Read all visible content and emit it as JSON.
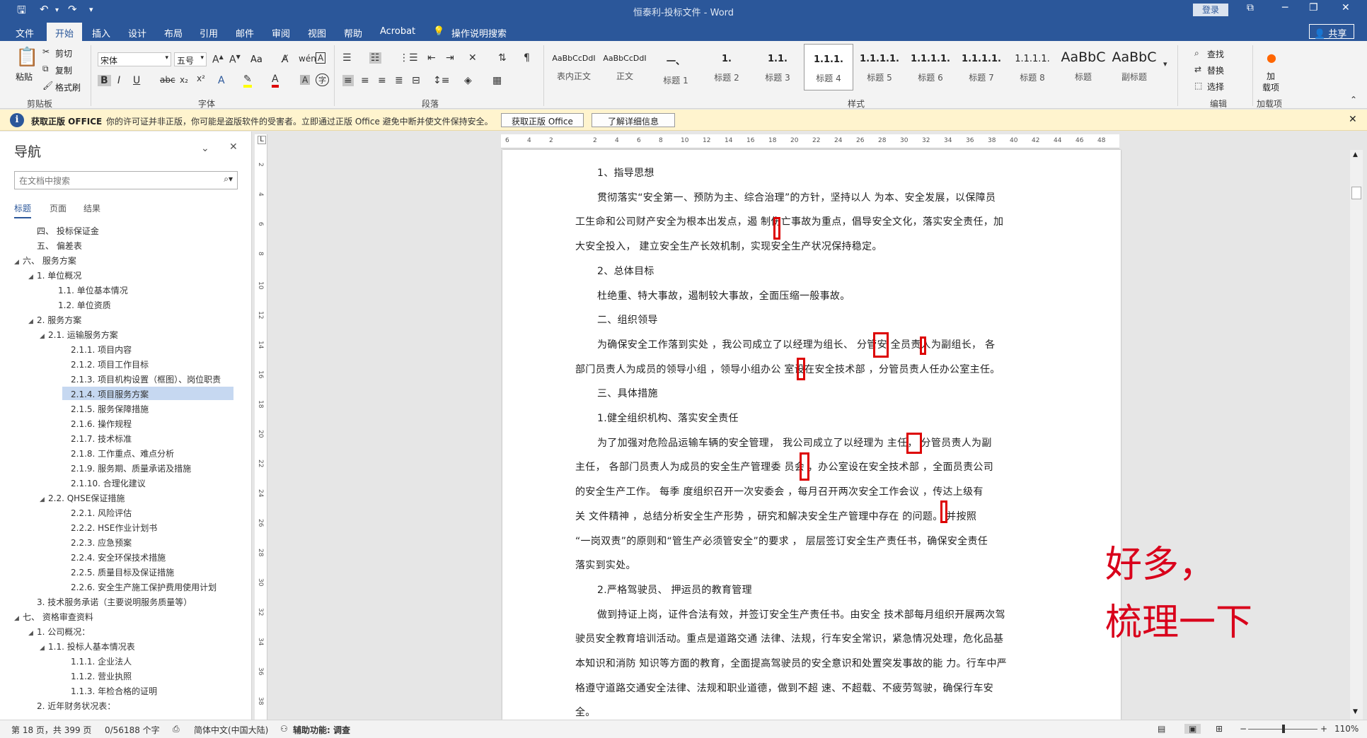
{
  "titlebar": {
    "title": "恒泰利-投标文件 - Word",
    "login": "登录",
    "save_icon": "save-icon",
    "undo_icon": "undo-icon",
    "redo_icon": "redo-icon"
  },
  "menu": {
    "tabs": [
      "文件",
      "开始",
      "插入",
      "设计",
      "布局",
      "引用",
      "邮件",
      "审阅",
      "视图",
      "帮助",
      "Acrobat"
    ],
    "tellme": "操作说明搜索",
    "share": "共享"
  },
  "ribbon": {
    "clipboard": {
      "paste": "粘贴",
      "cut": "剪切",
      "copy": "复制",
      "format_painter": "格式刷",
      "label": "剪贴板"
    },
    "font": {
      "name": "宋体",
      "size": "五号",
      "label": "字体",
      "aa": "Aa"
    },
    "paragraph": {
      "label": "段落"
    },
    "styles": {
      "label": "样式",
      "items": [
        {
          "preview": "AaBbCcDdI",
          "name": "表内正文"
        },
        {
          "preview": "AaBbCcDdI",
          "name": "正文"
        },
        {
          "preview": "一、",
          "name": "标题 1"
        },
        {
          "preview": "1.",
          "name": "标题 2"
        },
        {
          "preview": "1.1.",
          "name": "标题 3"
        },
        {
          "preview": "1.1.1.",
          "name": "标题 4"
        },
        {
          "preview": "1.1.1.1.",
          "name": "标题 5"
        },
        {
          "preview": "1.1.1.1.",
          "name": "标题 6"
        },
        {
          "preview": "1.1.1.1.",
          "name": "标题 7"
        },
        {
          "preview": "1.1.1.1.",
          "name": "标题 8"
        },
        {
          "preview": "AaBbC",
          "name": "标题"
        },
        {
          "preview": "AaBbC",
          "name": "副标题"
        }
      ]
    },
    "editing": {
      "find": "查找",
      "replace": "替换",
      "select": "选择",
      "label": "编辑"
    },
    "addins": {
      "btn": "加\n载项",
      "label": "加载项"
    }
  },
  "warning": {
    "title": "获取正版 OFFICE",
    "text": "你的许可证并非正版，你可能是盗版软件的受害者。立即通过正版 Office 避免中断并使文件保持安全。",
    "btn1": "获取正版 Office",
    "btn2": "了解详细信息"
  },
  "nav": {
    "title": "导航",
    "search_placeholder": "在文档中搜索",
    "tabs": [
      "标题",
      "页面",
      "结果"
    ],
    "items": [
      {
        "text": "四、 投标保证金",
        "level": 1,
        "tri": ""
      },
      {
        "text": "五、 偏差表",
        "level": 1,
        "tri": ""
      },
      {
        "text": "六、 服务方案",
        "level": 0,
        "tri": "◢"
      },
      {
        "text": "1. 单位概况",
        "level": 1,
        "tri": "◢"
      },
      {
        "text": "1.1. 单位基本情况",
        "level": 3,
        "tri": ""
      },
      {
        "text": "1.2. 单位资质",
        "level": 3,
        "tri": ""
      },
      {
        "text": "2. 服务方案",
        "level": 1,
        "tri": "◢"
      },
      {
        "text": "2.1. 运输服务方案",
        "level": 2,
        "tri": "◢"
      },
      {
        "text": "2.1.1. 项目内容",
        "level": 4,
        "tri": ""
      },
      {
        "text": "2.1.2. 项目工作目标",
        "level": 4,
        "tri": ""
      },
      {
        "text": "2.1.3. 项目机构设置（框图）、岗位职责",
        "level": 4,
        "tri": ""
      },
      {
        "text": "2.1.4. 项目服务方案",
        "level": 4,
        "tri": "",
        "selected": true
      },
      {
        "text": "2.1.5. 服务保障措施",
        "level": 4,
        "tri": ""
      },
      {
        "text": "2.1.6. 操作规程",
        "level": 4,
        "tri": ""
      },
      {
        "text": "2.1.7. 技术标准",
        "level": 4,
        "tri": ""
      },
      {
        "text": "2.1.8. 工作重点、难点分析",
        "level": 4,
        "tri": ""
      },
      {
        "text": "2.1.9. 服务期、质量承诺及措施",
        "level": 4,
        "tri": ""
      },
      {
        "text": "2.1.10. 合理化建议",
        "level": 4,
        "tri": ""
      },
      {
        "text": "2.2. QHSE保证措施",
        "level": 2,
        "tri": "◢"
      },
      {
        "text": "2.2.1. 风险评估",
        "level": 4,
        "tri": ""
      },
      {
        "text": "2.2.2. HSE作业计划书",
        "level": 4,
        "tri": ""
      },
      {
        "text": "2.2.3. 应急预案",
        "level": 4,
        "tri": ""
      },
      {
        "text": "2.2.4. 安全环保技术措施",
        "level": 4,
        "tri": ""
      },
      {
        "text": "2.2.5. 质量目标及保证措施",
        "level": 4,
        "tri": ""
      },
      {
        "text": "2.2.6. 安全生产施工保护费用使用计划",
        "level": 4,
        "tri": ""
      },
      {
        "text": "3. 技术服务承诺（主要说明服务质量等）",
        "level": 1,
        "tri": ""
      },
      {
        "text": "七、 资格审查资料",
        "level": 0,
        "tri": "◢"
      },
      {
        "text": "1. 公司概况：",
        "level": 1,
        "tri": "◢"
      },
      {
        "text": "1.1. 投标人基本情况表",
        "level": 2,
        "tri": "◢"
      },
      {
        "text": "1.1.1. 企业法人",
        "level": 4,
        "tri": ""
      },
      {
        "text": "1.1.2. 营业执照",
        "level": 4,
        "tri": ""
      },
      {
        "text": "1.1.3. 年检合格的证明",
        "level": 4,
        "tri": ""
      },
      {
        "text": "2. 近年财务状况表：",
        "level": 1,
        "tri": ""
      }
    ]
  },
  "ruler": {
    "ticks": [
      "6",
      "4",
      "2",
      "",
      "2",
      "4",
      "6",
      "8",
      "10",
      "12",
      "14",
      "16",
      "18",
      "20",
      "22",
      "24",
      "26",
      "28",
      "30",
      "32",
      "34",
      "36",
      "38",
      "40",
      "42",
      "44",
      "46",
      "48"
    ],
    "vticks": [
      "2",
      "4",
      "6",
      "8",
      "10",
      "12",
      "14",
      "16",
      "18",
      "20",
      "22",
      "24",
      "26",
      "28",
      "30",
      "32",
      "34",
      "36",
      "38"
    ]
  },
  "doc": {
    "lines": [
      {
        "text": "1、指导思想",
        "ind": true
      },
      {
        "text": "贯彻落实“安全第一、预防为主、综合治理”的方针，坚持以人 为本、安全发展，以保障员",
        "ind": true
      },
      {
        "text": "工生命和公司财产安全为根本出发点，遏 制伤亡事故为重点，倡导安全文化，落实安全责任，加",
        "ind": false
      },
      {
        "text": "大安全投入，  建立安全生产长效机制，实现安全生产状况保持稳定。",
        "ind": false
      },
      {
        "text": "2、总体目标",
        "ind": true
      },
      {
        "text": "杜绝重、特大事故，遏制较大事故，全面压缩一般事故。",
        "ind": true
      },
      {
        "text": "二、组织领导",
        "ind": true
      },
      {
        "text": "为确保安全工作落到实处 ，我公司成立了以经理为组长、   分管安 全员责人为副组长，  各",
        "ind": true
      },
      {
        "text": "部门员责人为成员的领导小组 ，领导小组办公 室设在安全技术部 ，分管员责人任办公室主任。",
        "ind": false
      },
      {
        "text": "三、具体措施",
        "ind": true
      },
      {
        "text": "1.健全组织机构、落实安全责任",
        "ind": true
      },
      {
        "text": "为了加强对危险品运输车辆的安全管理，  我公司成立了以经理为   主任，  分管员责人为副",
        "ind": true
      },
      {
        "text": "主任，  各部门员责人为成员的安全生产管理委   员会 ，办公室设在安全技术部 ，全面员责公司",
        "ind": false
      },
      {
        "text": "的安全生产工作。   每季    度组织召开一次安委会 ，每月召开两次安全工作会议 ，传达上级有",
        "ind": false
      },
      {
        "text": "关    文件精神 ，总结分析安全生产形势 ，研究和解决安全生产管理中存在    的问题。   并按照",
        "ind": false
      },
      {
        "text": "“一岗双责”的原则和“管生产必须管安全”的要求 ，  层层签订安全生产责任书，确保安全责任",
        "ind": false
      },
      {
        "text": "落实到实处。",
        "ind": false
      },
      {
        "text": "2.严格驾驶员、   押运员的教育管理",
        "ind": true
      },
      {
        "text": "做到持证上岗，证件合法有效，并签订安全生产责任书。由安全 技术部每月组织开展两次驾",
        "ind": true
      },
      {
        "text": "驶员安全教育培训活动。重点是道路交通 法律、法规，行车安全常识，紧急情况处理，危化品基",
        "ind": false
      },
      {
        "text": "本知识和消防 知识等方面的教育，全面提高驾驶员的安全意识和处置突发事故的能 力。行车中严",
        "ind": false
      },
      {
        "text": "格遵守道路交通安全法律、法规和职业道德，做到不超  速、不超载、不疲劳驾驶，确保行车安",
        "ind": false
      },
      {
        "text": "全。",
        "ind": false
      }
    ]
  },
  "annotation": {
    "line1": "好多，",
    "line2": "梳理一下"
  },
  "status": {
    "page": "第 18 页，共 399 页",
    "words": "0/56188 个字",
    "lang": "简体中文(中国大陆)",
    "access": "辅助功能: 调查",
    "zoom": "110%"
  },
  "colors": {
    "word_blue": "#2b579a",
    "mark_red": "#dd0000",
    "annot_red": "#d9001b"
  }
}
